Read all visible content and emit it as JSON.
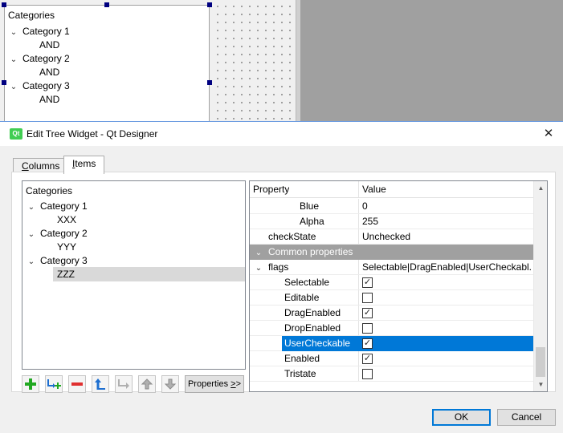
{
  "form_tree": {
    "rows": [
      {
        "label": "Categories"
      },
      {
        "label": "Category 1"
      },
      {
        "label": "AND"
      },
      {
        "label": "Category 2"
      },
      {
        "label": "AND"
      },
      {
        "label": "Category 3"
      },
      {
        "label": "AND"
      }
    ]
  },
  "dialog": {
    "title": "Edit Tree Widget - Qt Designer",
    "icon_text": "Qt",
    "close": "✕",
    "tabs": [
      {
        "label": "Columns",
        "mnemonic": "C",
        "rest": "olumns",
        "active": false
      },
      {
        "label": "Items",
        "mnemonic": "I",
        "rest": "tems",
        "active": true
      }
    ],
    "ok_label": "OK",
    "cancel_label": "Cancel"
  },
  "items_tree": {
    "header": "Categories",
    "rows": [
      {
        "label": "Category 1"
      },
      {
        "label": "XXX"
      },
      {
        "label": "Category 2"
      },
      {
        "label": "YYY"
      },
      {
        "label": "Category 3"
      },
      {
        "label": "ZZZ",
        "selected": true
      }
    ],
    "toolbar_icons": [
      "new-item-icon",
      "new-subitem-icon",
      "delete-item-icon",
      "move-left-icon",
      "move-right-icon",
      "move-up-icon",
      "move-down-icon"
    ],
    "properties_btn": "Properties >>",
    "properties_btn_text": "Properties ",
    "properties_btn_mnemonic": ">",
    "properties_btn_rest": ">"
  },
  "props": {
    "header_property": "Property",
    "header_value": "Value",
    "rows": [
      {
        "name": "Blue",
        "value": "0"
      },
      {
        "name": "Alpha",
        "value": "255"
      },
      {
        "name": "checkState",
        "value": "Unchecked"
      },
      {
        "name": "Common properties",
        "category": true
      },
      {
        "name": "flags",
        "value": "Selectable|DragEnabled|UserCheckabl..."
      },
      {
        "name": "Selectable",
        "checked": true
      },
      {
        "name": "Editable",
        "checked": false
      },
      {
        "name": "DragEnabled",
        "checked": true
      },
      {
        "name": "DropEnabled",
        "checked": false
      },
      {
        "name": "UserCheckable",
        "checked": true,
        "highlighted": true
      },
      {
        "name": "Enabled",
        "checked": true
      },
      {
        "name": "Tristate",
        "checked": false
      }
    ]
  },
  "colors": {
    "highlight": "#0078d7",
    "category_bg": "#a0a0a0",
    "selection_gray": "#d9d9d9",
    "qt_green": "#41cd52"
  }
}
